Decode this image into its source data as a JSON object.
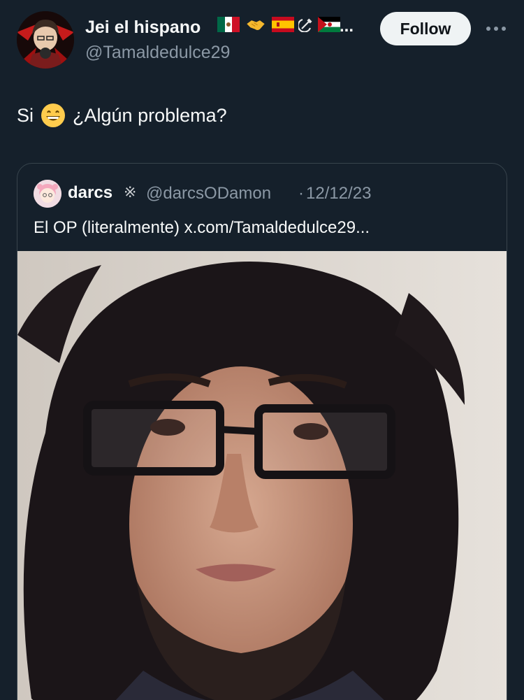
{
  "author": {
    "display_name": "Jei el hispano",
    "badges": [
      "mexico-flag-icon",
      "handshake-icon",
      "spain-flag-icon",
      "hammer-sickle-icon",
      "western-sahara-flag-icon"
    ],
    "name_overflow": "...",
    "handle": "@Tamaldedulce29",
    "avatar": "anime-avatar-icon"
  },
  "actions": {
    "follow_label": "Follow",
    "more_icon": "more-icon"
  },
  "tweet": {
    "text_before_emoji": "Si",
    "emoji": "grinning-face-icon",
    "text_after_emoji": "¿Algún problema?"
  },
  "quote": {
    "name": "darcs",
    "mark": "※",
    "handle": "@darcsODamon",
    "separator": "·",
    "date": "12/12/23",
    "text": "El OP (literalmente) x.com/Tamaldedulce29...",
    "photo": "selfie-photo"
  },
  "colors": {
    "background": "#15202b",
    "text_primary": "#f7f9f9",
    "text_secondary": "#8b98a5",
    "border": "#38444d",
    "follow_bg": "#eff3f4"
  }
}
